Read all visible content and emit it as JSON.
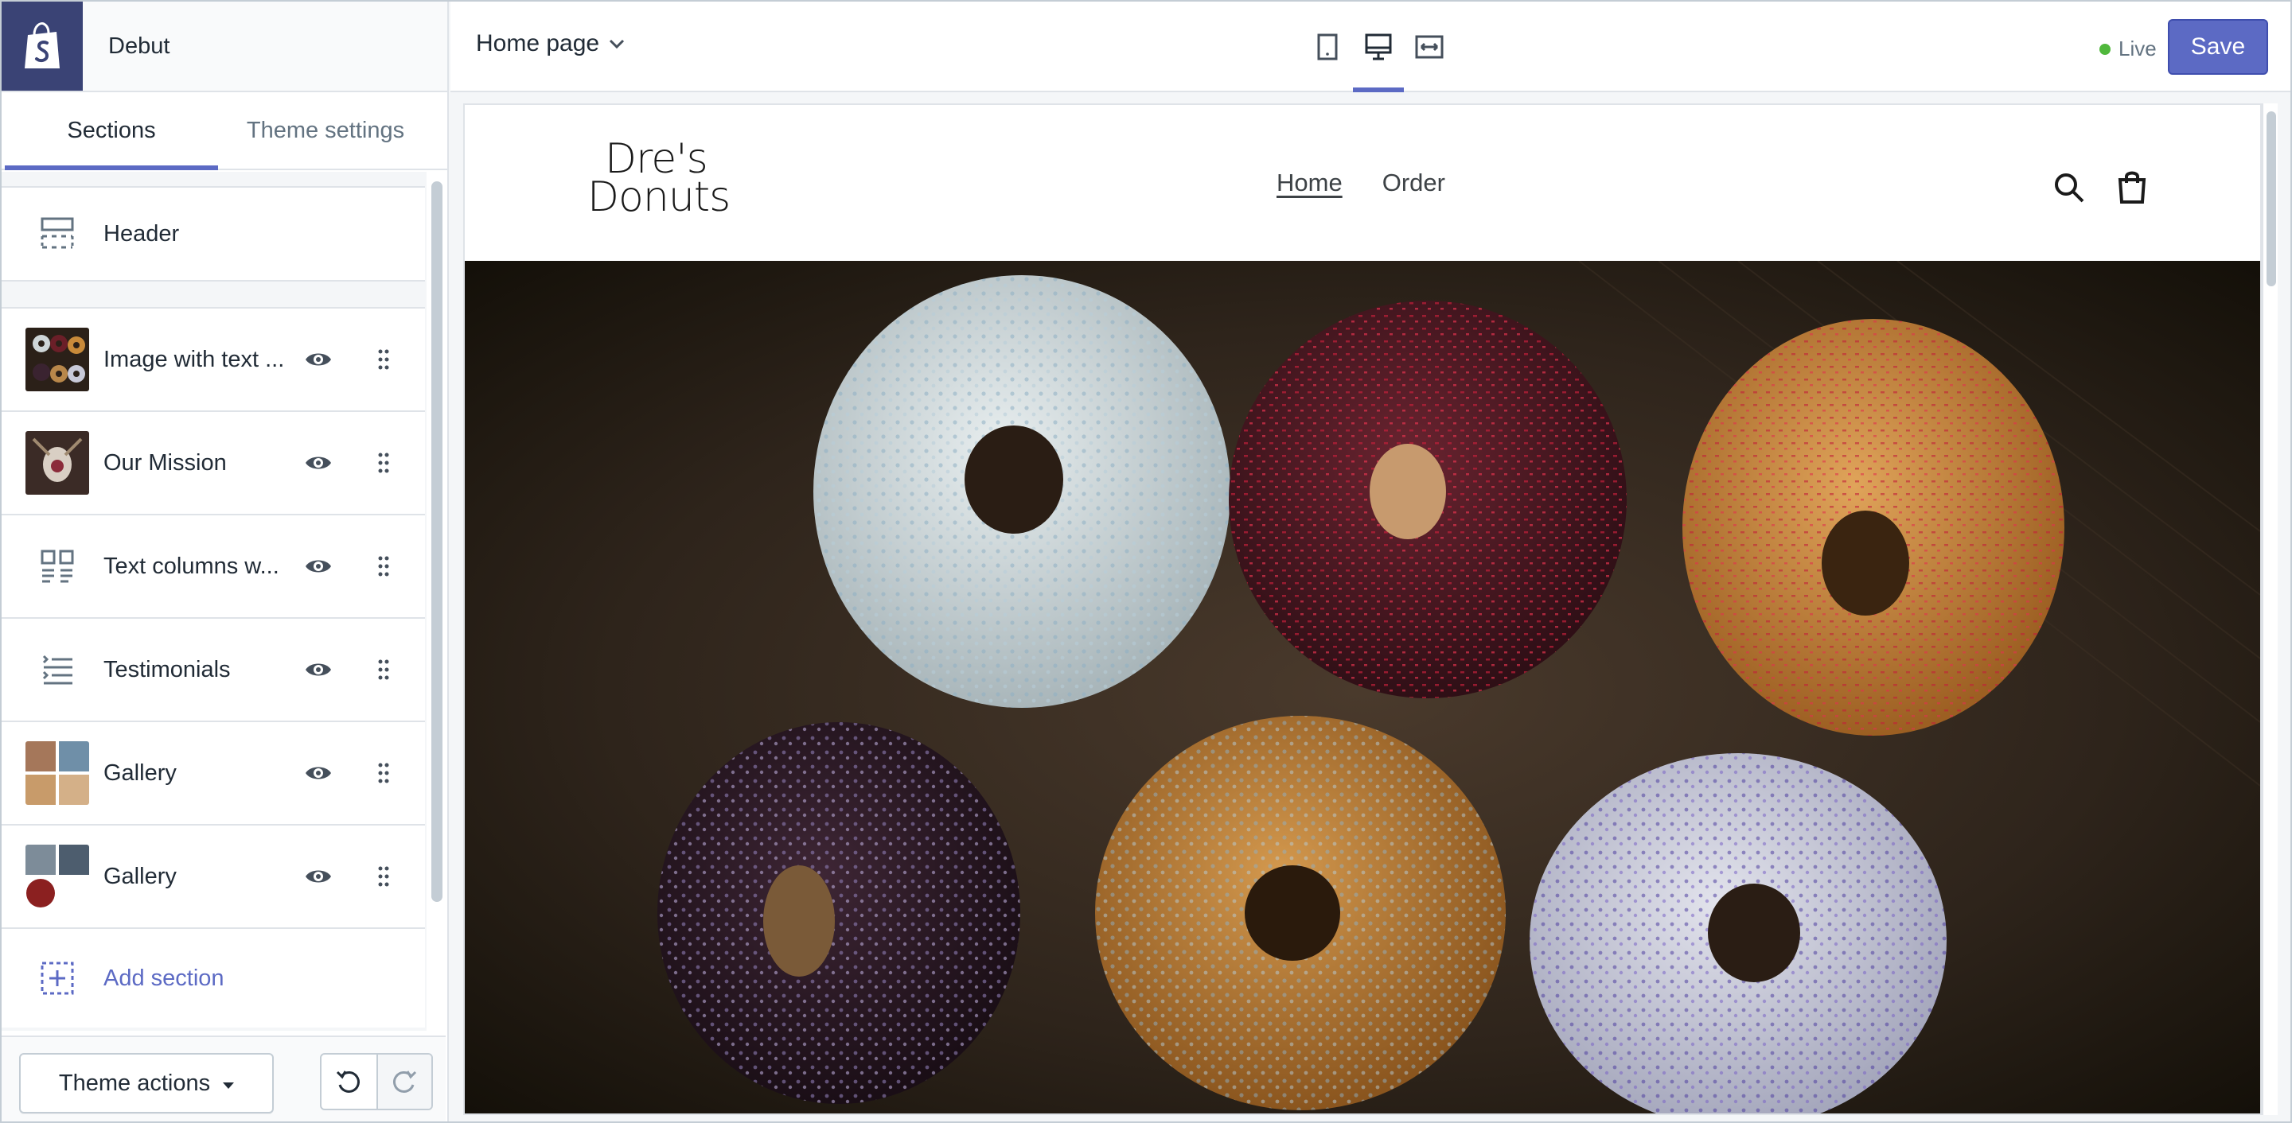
{
  "app": {
    "theme_name": "Debut",
    "logo_icon": "shopify-bag-icon"
  },
  "sidebar": {
    "tabs": [
      {
        "label": "Sections",
        "active": true
      },
      {
        "label": "Theme settings",
        "active": false
      }
    ],
    "header_item": {
      "label": "Header",
      "icon": "header-layout-icon"
    },
    "sections": [
      {
        "label": "Image with text ...",
        "thumb": "donuts-photo",
        "visible": true
      },
      {
        "label": "Our Mission",
        "thumb": "mission-photo",
        "visible": true
      },
      {
        "label": "Text columns w...",
        "icon": "text-columns-icon",
        "visible": true
      },
      {
        "label": "Testimonials",
        "icon": "testimonials-icon",
        "visible": true
      },
      {
        "label": "Gallery",
        "thumb": "gallery-collage-1",
        "visible": true
      },
      {
        "label": "Gallery",
        "thumb": "gallery-collage-2",
        "visible": true
      }
    ],
    "add_section_label": "Add section",
    "footer": {
      "theme_actions_label": "Theme actions"
    }
  },
  "topbar": {
    "page_select": "Home page",
    "devices": [
      {
        "name": "mobile",
        "active": false
      },
      {
        "name": "desktop",
        "active": true
      },
      {
        "name": "fullscreen",
        "active": false
      }
    ],
    "status_label": "Live",
    "save_label": "Save"
  },
  "store": {
    "logo_line1": "Dre's",
    "logo_line2": "Donuts",
    "nav": [
      {
        "label": "Home",
        "active": true
      },
      {
        "label": "Order",
        "active": false
      }
    ]
  },
  "colors": {
    "accent": "#5c6ac4",
    "nav_dark": "#3a4375",
    "live_dot": "#50b83c"
  }
}
